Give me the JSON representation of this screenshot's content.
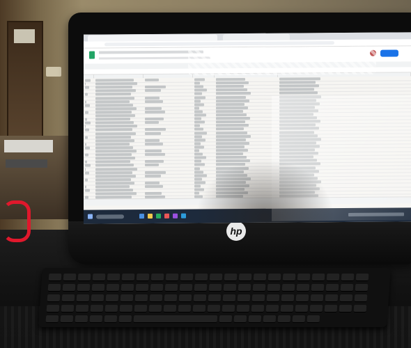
{
  "photo": {
    "subject": "hp-all-in-one-monitor-with-spreadsheet",
    "brand_logo_text": "hp",
    "icons": {
      "logo": "hp-logo",
      "app": "google-sheets-icon",
      "share": "share-button"
    },
    "colors": {
      "sheets_green": "#23a566",
      "share_blue": "#1a73e8",
      "taskbar": "#1d2a3c",
      "cable_red": "#e0182c"
    }
  }
}
